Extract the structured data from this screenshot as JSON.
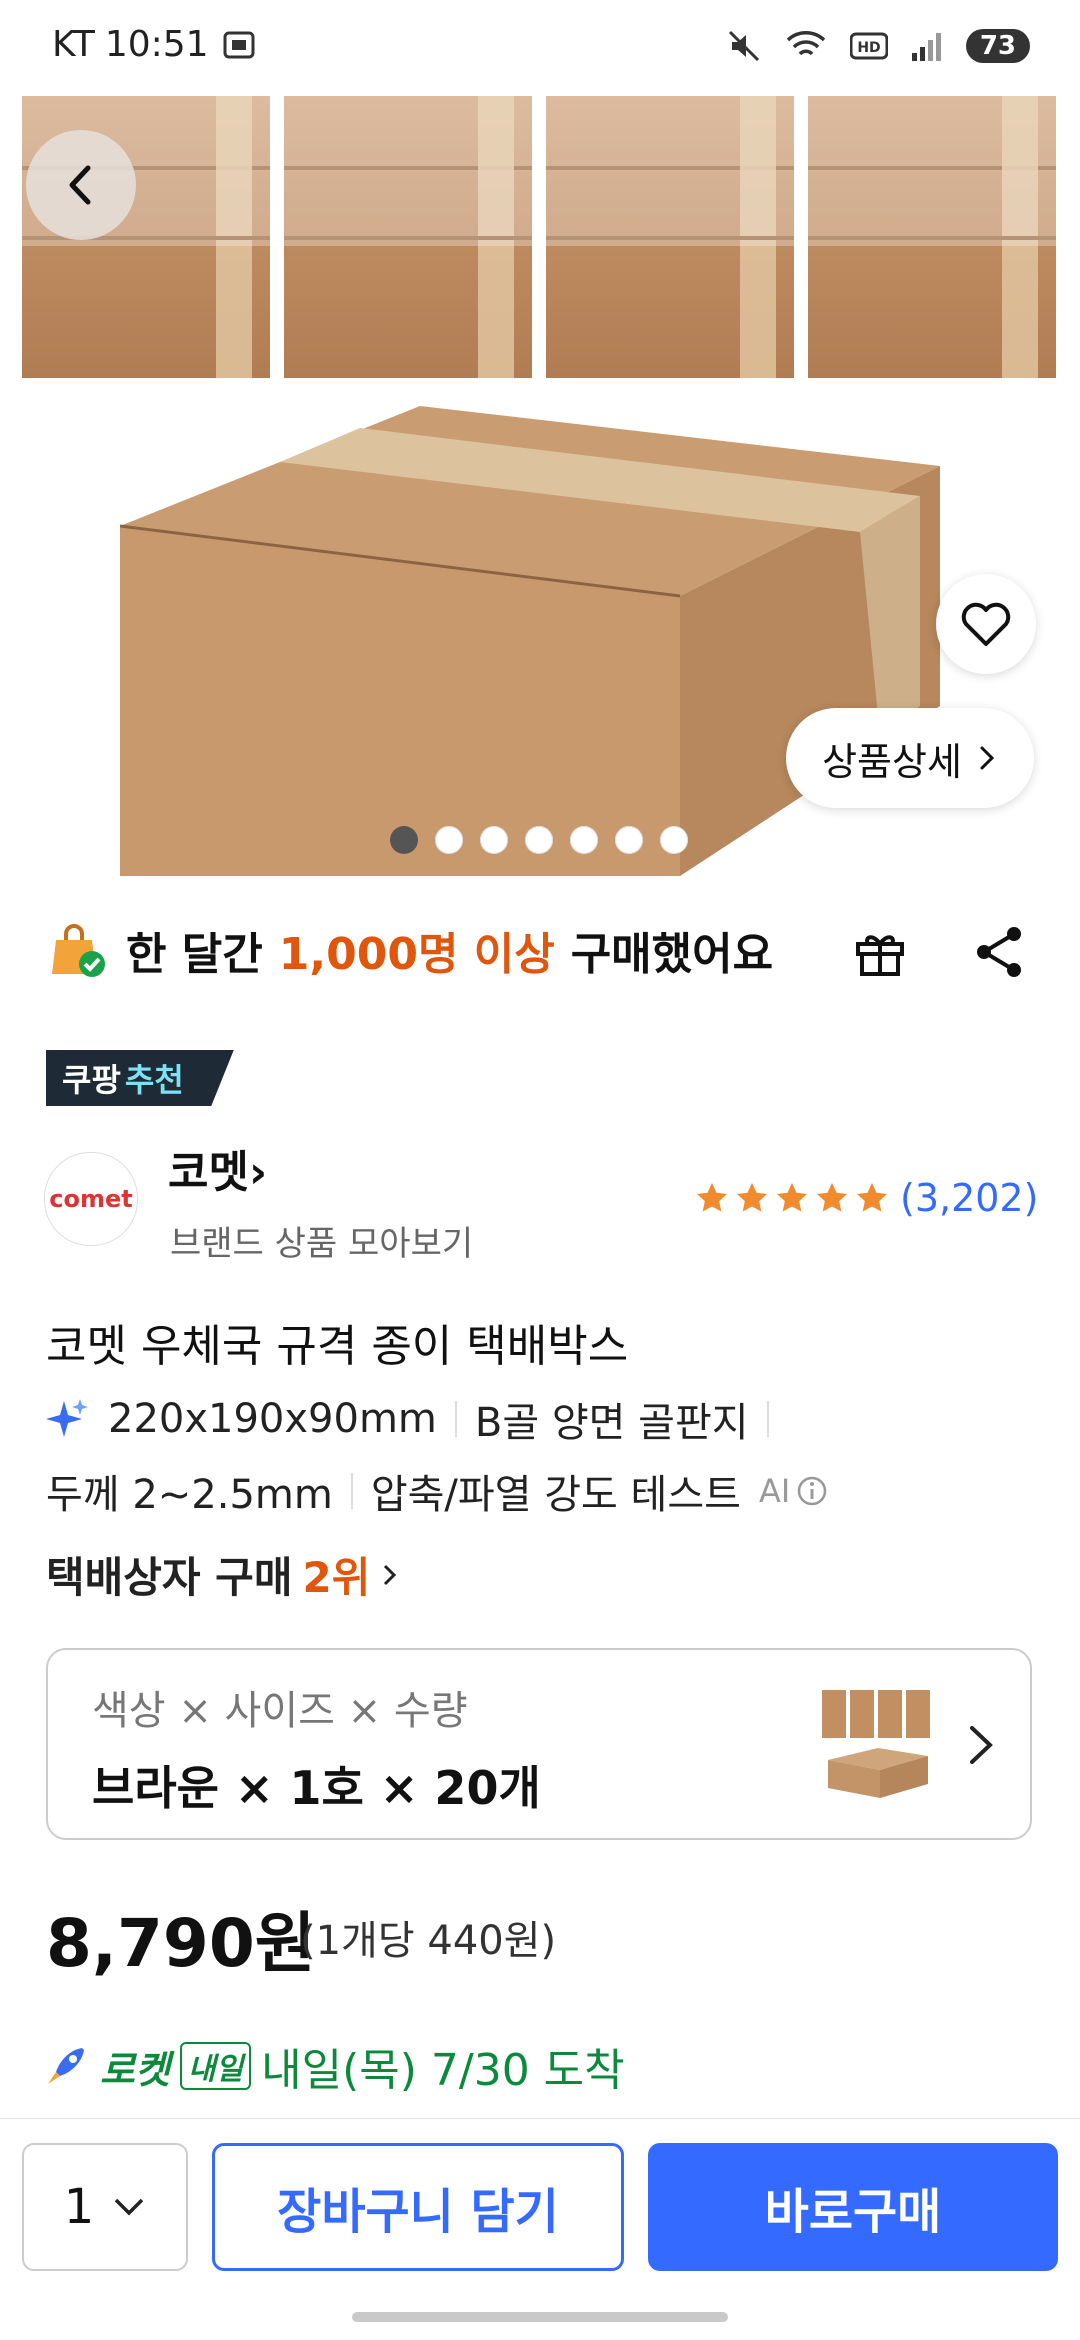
{
  "status_bar": {
    "carrier": "KT",
    "time": "10:51",
    "battery": "73",
    "icons": [
      "screenshot-icon",
      "mute-icon",
      "wifi-icon",
      "hd-icon",
      "signal-icon",
      "battery-icon"
    ]
  },
  "hero": {
    "image_count": 7,
    "active_index": 0,
    "detail_label": "상품상세"
  },
  "stats": {
    "prefix": "한 달간",
    "highlight": "1,000명 이상",
    "suffix": "구매했어요"
  },
  "badge": {
    "part1": "쿠팡",
    "part2": "추천"
  },
  "brand": {
    "logo_text": "comet",
    "name": "코멧",
    "sub": "브랜드 상품 모아보기",
    "rating": 5,
    "review_count": "(3,202)"
  },
  "product": {
    "title": "코멧 우체국 규격 종이 택배박스",
    "specs_line1": [
      "220x190x90mm",
      "B골 양면 골판지"
    ],
    "specs_line2": [
      "두께 2~2.5mm",
      "압축/파열 강도 테스트"
    ],
    "ai_label": "AI",
    "rank_prefix": "택배상자 구매",
    "rank_value": "2위"
  },
  "options": {
    "label": "색상 × 사이즈 × 수량",
    "value": "브라운 × 1호 × 20개"
  },
  "price": {
    "main": "8,790원",
    "unit": "(1개당 440원)"
  },
  "delivery": {
    "rocket_label": "로켓",
    "badge": "내일",
    "date": "내일(목) 7/30 도착"
  },
  "bottom_bar": {
    "quantity": "1",
    "cart_label": "장바구니 담기",
    "buy_label": "바로구매"
  },
  "colors": {
    "primary": "#346aff",
    "highlight": "#e0560c",
    "rocket_green": "#0c8a3c",
    "star": "#f28b2b"
  }
}
